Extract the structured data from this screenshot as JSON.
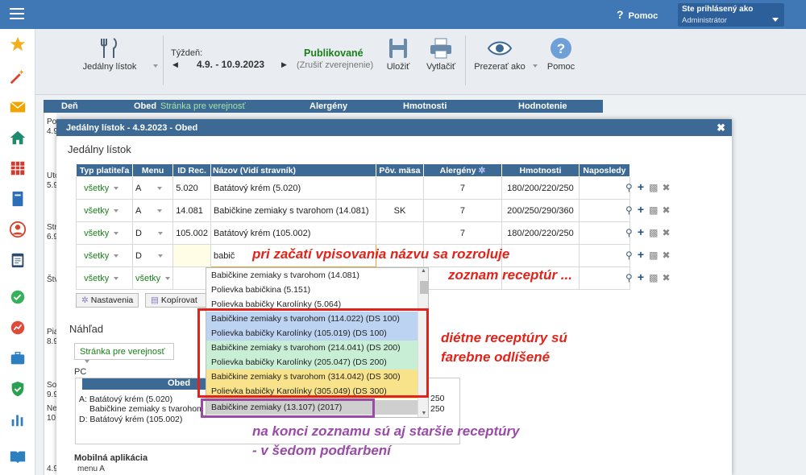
{
  "topbar": {
    "help_label": "Pomoc",
    "user_label": "Ste prihlásený ako",
    "user_value": "Administrátor"
  },
  "toolbar": {
    "menu_label": "Jedálny lístok",
    "week_label": "Týždeň:",
    "week_value": "4.9. - 10.9.2023",
    "status": "Publikované",
    "status_sub": "(Zrušiť zverejnenie)",
    "save": "Uložiť",
    "print": "Vytlačiť",
    "view_as": "Prezerať ako",
    "help": "Pomoc"
  },
  "bg": {
    "headers": [
      "Deň",
      "Obed",
      "Stránka pre verejnosť",
      "Alergény",
      "Hmotnosti",
      "Hodnotenie"
    ],
    "days": [
      "Po",
      "4.9",
      "Uto",
      "5.9",
      "Str",
      "6.9",
      "Štv",
      "Pia",
      "8.9",
      "So",
      "9.9",
      "Ne",
      "10.",
      "4.9"
    ],
    "right_vals": [
      "250",
      "250"
    ]
  },
  "modal": {
    "title": "Jedálny lístok - 4.9.2023 - Obed",
    "section": "Jedálny lístok",
    "columns": [
      "Typ platiteľa",
      "Menu",
      "ID Rec.",
      "Názov (Vidí stravník)",
      "Pôv. mäsa",
      "Alergény",
      "Hmotnosti",
      "Naposledy"
    ],
    "rows": [
      {
        "payer": "všetky",
        "menu": "A",
        "id": "5.020",
        "name": "Batátový krém (5.020)",
        "origin": "",
        "allergens": "7",
        "weights": "180/200/220/250"
      },
      {
        "payer": "všetky",
        "menu": "A",
        "id": "14.081",
        "name": "Babičkine zemiaky s tvarohom (14.081)",
        "origin": "SK",
        "allergens": "7",
        "weights": "200/250/290/360"
      },
      {
        "payer": "všetky",
        "menu": "D",
        "id": "105.002",
        "name": "Batátový krém (105.002)",
        "origin": "",
        "allergens": "7",
        "weights": "180/200/220/250"
      },
      {
        "payer": "všetky",
        "menu": "D",
        "id": "",
        "name": "babič",
        "origin": "",
        "allergens": "",
        "weights": ""
      },
      {
        "payer": "všetky",
        "menu": "všetky",
        "id": "",
        "name": "",
        "origin": "",
        "allergens": "",
        "weights": ""
      }
    ],
    "btn_settings": "Nastavenia",
    "btn_copy": "Kopírovat",
    "preview_title": "Náhľad",
    "preview_select": "Stránka pre verejnosť",
    "pc_label": "PC",
    "preview_header": "Obed",
    "preview_lines": [
      "A: Batátový krém (5.020)",
      "Babičkine zemiaky s tvarohom",
      "D: Batátový krém (105.002)"
    ],
    "mobile_label": "Mobilná aplikácia",
    "mobile_line": "menu A"
  },
  "dropdown": [
    "Babičkine zemiaky s tvarohom (14.081)",
    "Polievka babičkina (5.151)",
    "Polievka babičky Karolínky (5.064)",
    "Babičkine zemiaky s tvarohom (114.022) (DS 100)",
    "Polievka babičky Karolínky (105.019) (DS 100)",
    "Babičkine zemiaky s tvarohom (214.041) (DS 200)",
    "Polievka babičky Karolínky (205.047) (DS 200)",
    "Babičkine zemiaky s tvarohom (314.042) (DS 300)",
    "Polievka babičky Karolínky (305.049) (DS 300)",
    "Babičkine zemiaky (13.107) (2017)"
  ],
  "annotations": {
    "a1": "pri začatí vpisovania názvu sa rozroluje",
    "a2": "zoznam receptúr ...",
    "a3": "diétne receptúry sú",
    "a4": "farebne odlíšené",
    "a5": "na konci zoznamu sú aj staršie receptúry",
    "a6": "- v šedom podfarbení"
  },
  "colors": {
    "header_blue": "#3d6a94",
    "topbar": "#3f78b4",
    "annotation_red": "#e2231a",
    "annotation_purple": "#9a4aa8",
    "published_green": "#1a7f1a"
  }
}
